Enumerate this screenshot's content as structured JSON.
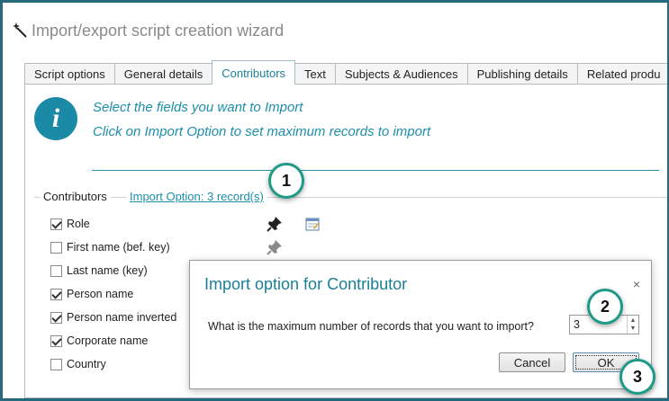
{
  "window": {
    "title": "Import/export script creation wizard"
  },
  "tabs": [
    {
      "label": "Script options"
    },
    {
      "label": "General details"
    },
    {
      "label": "Contributors"
    },
    {
      "label": "Text"
    },
    {
      "label": "Subjects & Audiences"
    },
    {
      "label": "Publishing details"
    },
    {
      "label": "Related produ"
    }
  ],
  "instructions": {
    "line1": "Select the fields you want to Import",
    "line2": "Click on Import Option to set maximum records to import"
  },
  "group": {
    "label": "Contributors",
    "import_link": "Import Option: 3  record(s)"
  },
  "fields": [
    {
      "label": "Role",
      "checked": true
    },
    {
      "label": "First name (bef. key)",
      "checked": false
    },
    {
      "label": "Last name (key)",
      "checked": false
    },
    {
      "label": "Person name",
      "checked": true
    },
    {
      "label": "Person name inverted",
      "checked": true
    },
    {
      "label": "Corporate name",
      "checked": true
    },
    {
      "label": "Country",
      "checked": false
    }
  ],
  "dialog": {
    "title": "Import option for Contributor",
    "close": "×",
    "question": "What is the maximum number of records that you want to import?",
    "value": "3",
    "cancel_label": "Cancel",
    "ok_label": "OK"
  },
  "badges": [
    "1",
    "2",
    "3"
  ],
  "colors": {
    "accent": "#1b8fab",
    "frame": "#26697d",
    "badge_ring": "#1e9a87"
  }
}
